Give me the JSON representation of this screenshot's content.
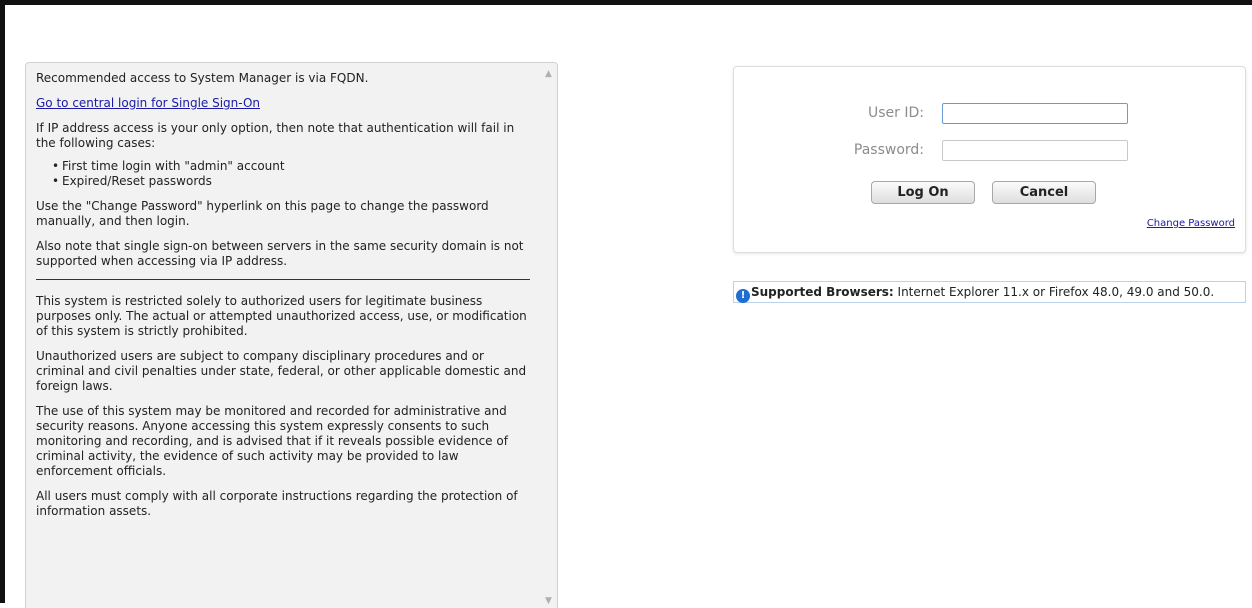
{
  "info_panel": {
    "fqdn_note": "Recommended access to System Manager is via FQDN.",
    "sso_link": "Go to central login for Single Sign-On",
    "ip_note": "If IP address access is your only option, then note that authentication will fail in the following cases:",
    "cases": [
      "First time login with \"admin\" account",
      "Expired/Reset passwords"
    ],
    "change_password_note": "Use the \"Change Password\" hyperlink on this page to change the password manually, and then login.",
    "sso_note": "Also note that single sign-on between servers in the same security domain is not supported when accessing via IP address.",
    "restricted_note": "This system is restricted solely to authorized users for legitimate business purposes only. The actual or attempted unauthorized access, use, or modification of this system is strictly prohibited.",
    "unauthorized_note": "Unauthorized users are subject to company disciplinary procedures and or criminal and civil penalties under state, federal, or other applicable domestic and foreign laws.",
    "monitoring_note": "The use of this system may be monitored and recorded for administrative and security reasons. Anyone accessing this system expressly consents to such monitoring and recording, and is advised that if it reveals possible evidence of criminal activity, the evidence of such activity may be provided to law enforcement officials.",
    "compliance_note": "All users must comply with all corporate instructions regarding the protection of information assets."
  },
  "login": {
    "userid_label": "User ID:",
    "userid_value": "",
    "password_label": "Password:",
    "password_value": "",
    "logon_button": "Log On",
    "cancel_button": "Cancel",
    "change_password_link": "Change Password"
  },
  "browser_notice": {
    "icon": "info-icon",
    "label": "Supported Browsers:",
    "text": " Internet Explorer 11.x or Firefox 48.0, 49.0 and 50.0."
  },
  "colors": {
    "link": "#1a1aa6",
    "panel_bg": "#f2f2f2",
    "info_icon": "#1e6fd0"
  }
}
